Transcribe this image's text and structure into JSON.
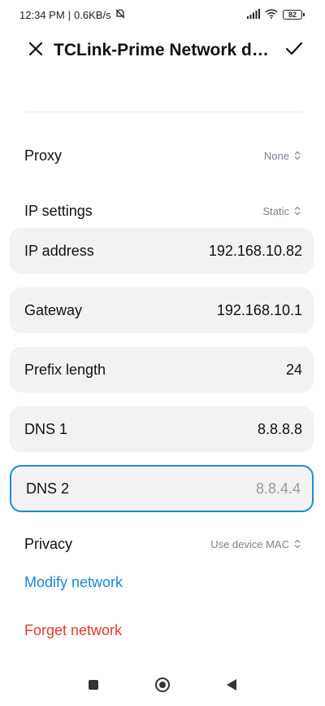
{
  "status_bar": {
    "time": "12:34 PM",
    "speed": "0.6KB/s",
    "battery": "82"
  },
  "header": {
    "title": "TCLink-Prime Network detai..."
  },
  "proxy": {
    "label": "Proxy",
    "value": "None"
  },
  "ip_settings": {
    "label": "IP settings",
    "value": "Static"
  },
  "fields": {
    "ip_address": {
      "label": "IP address",
      "value": "192.168.10.82"
    },
    "gateway": {
      "label": "Gateway",
      "value": "192.168.10.1"
    },
    "prefix_length": {
      "label": "Prefix length",
      "value": "24"
    },
    "dns1": {
      "label": "DNS 1",
      "value": "8.8.8.8"
    },
    "dns2": {
      "label": "DNS 2",
      "placeholder": "8.8.4.4"
    }
  },
  "privacy": {
    "label": "Privacy",
    "value": "Use device MAC"
  },
  "actions": {
    "modify": "Modify network",
    "forget": "Forget network"
  },
  "colors": {
    "accent": "#1e8bd6",
    "link_blue": "#1a86dc",
    "danger_red": "#e23b2a",
    "field_bg": "#f2f2f2"
  }
}
